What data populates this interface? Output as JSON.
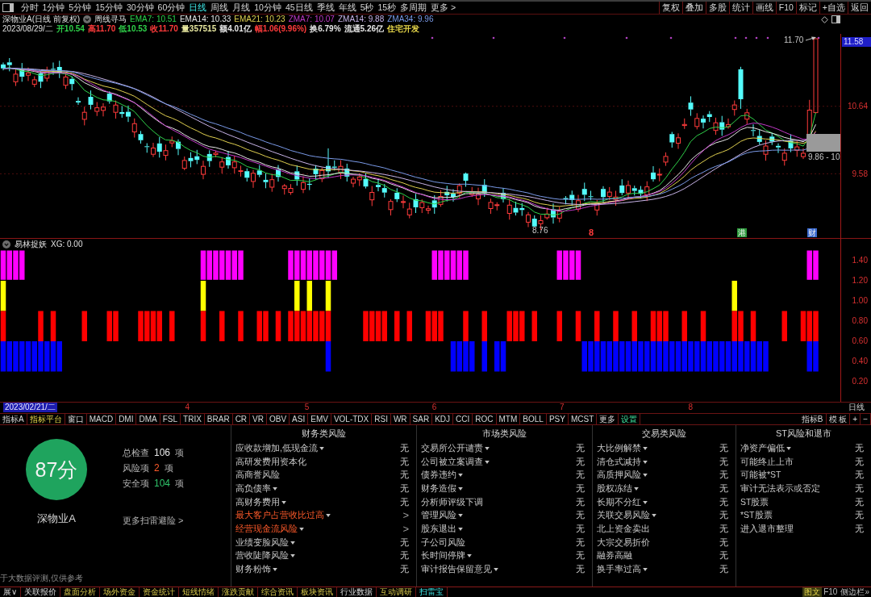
{
  "toolbar": {
    "periods": [
      {
        "label": "分时",
        "selected": false
      },
      {
        "label": "1分钟",
        "selected": false
      },
      {
        "label": "5分钟",
        "selected": false
      },
      {
        "label": "15分钟",
        "selected": false
      },
      {
        "label": "30分钟",
        "selected": false
      },
      {
        "label": "60分钟",
        "selected": false
      },
      {
        "label": "日线",
        "selected": true
      },
      {
        "label": "周线",
        "selected": false
      },
      {
        "label": "月线",
        "selected": false
      },
      {
        "label": "10分钟",
        "selected": false
      },
      {
        "label": "45日线",
        "selected": false
      },
      {
        "label": "季线",
        "selected": false
      },
      {
        "label": "年线",
        "selected": false
      },
      {
        "label": "5秒",
        "selected": false
      },
      {
        "label": "15秒",
        "selected": false
      },
      {
        "label": "多周期",
        "selected": false
      }
    ],
    "more": "更多 >",
    "actions": [
      "复权",
      "叠加",
      "多股",
      "统计",
      "画线",
      "F10",
      "标记",
      "+自选",
      "返回"
    ]
  },
  "quote_header": {
    "title": "深物业A(日线 前复权)",
    "formula": "周线寻马",
    "averages": [
      {
        "text": "EMA7: 10.51",
        "color": "#2fd24a"
      },
      {
        "text": "EMA14: 10.33",
        "color": "#e6e6e6"
      },
      {
        "text": "EMA21: 10.23",
        "color": "#e0d050"
      },
      {
        "text": "ZMA7: 10.07",
        "color": "#c23ac8"
      },
      {
        "text": "ZMA14: 9.88",
        "color": "#c8b4e8"
      },
      {
        "text": "ZMA34: 9.96",
        "color": "#7a9ae8"
      }
    ]
  },
  "quote_line": {
    "date": "2023/08/29/二",
    "fields": [
      {
        "text": "开10.54",
        "color": "#2fd24a"
      },
      {
        "text": "高11.70",
        "color": "#ff3b3b"
      },
      {
        "text": "低10.53",
        "color": "#2fd24a"
      },
      {
        "text": "收11.70",
        "color": "#ff3b3b"
      },
      {
        "text": "量357515",
        "color": "#e8e8a0"
      },
      {
        "text": "额4.01亿",
        "color": "#e6e6e6"
      },
      {
        "text": "幅1.06(9.96%)",
        "color": "#ff3b3b"
      },
      {
        "text": "换6.79%",
        "color": "#e6e6e6"
      },
      {
        "text": "流通5.26亿",
        "color": "#e6e6e6"
      },
      {
        "text": "住宅开发",
        "color": "#e8d84a"
      }
    ]
  },
  "price_chart": {
    "axis_labels": [
      {
        "text": "11.58",
        "kind": "current"
      },
      {
        "text": "10.64",
        "kind": "tick"
      },
      {
        "text": "9.58",
        "kind": "tick"
      }
    ],
    "high_label": "11.70",
    "low_label": "8.76",
    "range_label": "9.86 - 10",
    "event_marks": [
      {
        "text": "8",
        "kind": "plain",
        "color": "#ff3b3b"
      },
      {
        "text": "港",
        "kind": "boxed",
        "color": "#2a9a3a"
      },
      {
        "text": "财",
        "kind": "boxed",
        "color": "#3a6ad0"
      }
    ]
  },
  "indicator_panel": {
    "title": "易林捉妖",
    "reading": "XG: 0.00",
    "axis_labels": [
      "1.40",
      "1.20",
      "1.00",
      "0.80",
      "0.60",
      "0.40",
      "0.20"
    ]
  },
  "date_axis": {
    "start": "2023/02/21/二",
    "months": [
      "4",
      "5",
      "6",
      "7",
      "8"
    ],
    "period": "日线"
  },
  "indicator_tabs": {
    "tabs": [
      {
        "label": "指标A",
        "kind": "plain"
      },
      {
        "label": "指标平台",
        "kind": "accent"
      },
      {
        "label": "窗口",
        "kind": "plain"
      },
      {
        "label": "MACD",
        "kind": "plain"
      },
      {
        "label": "DMI",
        "kind": "plain"
      },
      {
        "label": "DMA",
        "kind": "plain"
      },
      {
        "label": "FSL",
        "kind": "plain"
      },
      {
        "label": "TRIX",
        "kind": "plain"
      },
      {
        "label": "BRAR",
        "kind": "plain"
      },
      {
        "label": "CR",
        "kind": "plain"
      },
      {
        "label": "VR",
        "kind": "plain"
      },
      {
        "label": "OBV",
        "kind": "plain"
      },
      {
        "label": "ASI",
        "kind": "plain"
      },
      {
        "label": "EMV",
        "kind": "plain"
      },
      {
        "label": "VOL-TDX",
        "kind": "plain"
      },
      {
        "label": "RSI",
        "kind": "plain"
      },
      {
        "label": "WR",
        "kind": "plain"
      },
      {
        "label": "SAR",
        "kind": "plain"
      },
      {
        "label": "KDJ",
        "kind": "plain"
      },
      {
        "label": "CCI",
        "kind": "plain"
      },
      {
        "label": "ROC",
        "kind": "plain"
      },
      {
        "label": "MTM",
        "kind": "plain"
      },
      {
        "label": "BOLL",
        "kind": "plain"
      },
      {
        "label": "PSY",
        "kind": "plain"
      },
      {
        "label": "MCST",
        "kind": "plain"
      },
      {
        "label": "更多",
        "kind": "plain"
      },
      {
        "label": "设置",
        "kind": "link"
      }
    ],
    "right": [
      "指标B",
      "模 板",
      "+",
      "−"
    ]
  },
  "risk_scan": {
    "score": "87分",
    "stock": "深物业A",
    "stats": [
      {
        "label": "总检查",
        "value": "106",
        "unit": "项",
        "kind": "total"
      },
      {
        "label": "风险项",
        "value": "2",
        "unit": "项",
        "kind": "risk"
      },
      {
        "label": "安全项",
        "value": "104",
        "unit": "项",
        "kind": "safe"
      }
    ],
    "more_link": "更多扫雷避险 >",
    "footnote": "于大数据评测,仅供参考",
    "categories": [
      {
        "title": "财务类风险",
        "items": [
          {
            "label": "应收款增加,低现金流",
            "expandable": true,
            "flagged": false,
            "result": "无"
          },
          {
            "label": "高研发费用资本化",
            "expandable": false,
            "flagged": false,
            "result": "无"
          },
          {
            "label": "高商誉风险",
            "expandable": false,
            "flagged": false,
            "result": "无"
          },
          {
            "label": "高负债率",
            "expandable": true,
            "flagged": false,
            "result": "无"
          },
          {
            "label": "高财务费用",
            "expandable": true,
            "flagged": false,
            "result": "无"
          },
          {
            "label": "最大客户占营收比过高",
            "expandable": true,
            "flagged": true,
            "result": ">"
          },
          {
            "label": "经营现金流风险",
            "expandable": true,
            "flagged": true,
            "result": ">"
          },
          {
            "label": "业绩变脸风险",
            "expandable": true,
            "flagged": false,
            "result": "无"
          },
          {
            "label": "营收陡降风险",
            "expandable": true,
            "flagged": false,
            "result": "无"
          },
          {
            "label": "财务粉饰",
            "expandable": true,
            "flagged": false,
            "result": "无"
          }
        ]
      },
      {
        "title": "市场类风险",
        "items": [
          {
            "label": "交易所公开谴责",
            "expandable": true,
            "flagged": false,
            "result": "无"
          },
          {
            "label": "公司被立案调查",
            "expandable": true,
            "flagged": false,
            "result": "无"
          },
          {
            "label": "债券违约",
            "expandable": true,
            "flagged": false,
            "result": "无"
          },
          {
            "label": "财务造假",
            "expandable": true,
            "flagged": false,
            "result": "无"
          },
          {
            "label": "分析师评级下调",
            "expandable": false,
            "flagged": false,
            "result": "无"
          },
          {
            "label": "管理风险",
            "expandable": true,
            "flagged": false,
            "result": "无"
          },
          {
            "label": "股东退出",
            "expandable": true,
            "flagged": false,
            "result": "无"
          },
          {
            "label": "子公司风险",
            "expandable": false,
            "flagged": false,
            "result": "无"
          },
          {
            "label": "长时间停牌",
            "expandable": true,
            "flagged": false,
            "result": "无"
          },
          {
            "label": "审计报告保留意见",
            "expandable": true,
            "flagged": false,
            "result": "无"
          }
        ]
      },
      {
        "title": "交易类风险",
        "items": [
          {
            "label": "大比例解禁",
            "expandable": true,
            "flagged": false,
            "result": "无"
          },
          {
            "label": "清仓式减持",
            "expandable": true,
            "flagged": false,
            "result": "无"
          },
          {
            "label": "高质押风险",
            "expandable": true,
            "flagged": false,
            "result": "无"
          },
          {
            "label": "股权冻结",
            "expandable": true,
            "flagged": false,
            "result": "无"
          },
          {
            "label": "长期不分红",
            "expandable": true,
            "flagged": false,
            "result": "无"
          },
          {
            "label": "关联交易风险",
            "expandable": true,
            "flagged": false,
            "result": "无"
          },
          {
            "label": "北上资金卖出",
            "expandable": false,
            "flagged": false,
            "result": "无"
          },
          {
            "label": "大宗交易折价",
            "expandable": false,
            "flagged": false,
            "result": "无"
          },
          {
            "label": "融券高融",
            "expandable": false,
            "flagged": false,
            "result": "无"
          },
          {
            "label": "换手率过高",
            "expandable": true,
            "flagged": false,
            "result": "无"
          }
        ]
      },
      {
        "title": "ST风险和退市",
        "items": [
          {
            "label": "净资产偏低",
            "expandable": true,
            "flagged": false,
            "result": "无"
          },
          {
            "label": "可能终止上市",
            "expandable": false,
            "flagged": false,
            "result": "无"
          },
          {
            "label": "可能被*ST",
            "expandable": false,
            "flagged": false,
            "result": "无"
          },
          {
            "label": "审计无法表示或否定",
            "expandable": false,
            "flagged": false,
            "result": "无"
          },
          {
            "label": "ST股票",
            "expandable": false,
            "flagged": false,
            "result": "无"
          },
          {
            "label": "*ST股票",
            "expandable": false,
            "flagged": false,
            "result": "无"
          },
          {
            "label": "进入退市整理",
            "expandable": false,
            "flagged": false,
            "result": "无"
          }
        ]
      }
    ]
  },
  "bottom_tabs": [
    {
      "label": "展∨",
      "kind": "plain",
      "selected": false
    },
    {
      "label": "关联报价",
      "kind": "plain",
      "selected": false
    },
    {
      "label": "盘面分析",
      "kind": "feature",
      "selected": false
    },
    {
      "label": "场外资金",
      "kind": "feature",
      "selected": false
    },
    {
      "label": "资金统计",
      "kind": "feature",
      "selected": false
    },
    {
      "label": "短线情绪",
      "kind": "feature",
      "selected": false
    },
    {
      "label": "涨跌贡献",
      "kind": "feature",
      "selected": false
    },
    {
      "label": "综合资讯",
      "kind": "feature",
      "selected": false
    },
    {
      "label": "板块资讯",
      "kind": "feature",
      "selected": false
    },
    {
      "label": "行业数据",
      "kind": "plain",
      "selected": false
    },
    {
      "label": "互动调研",
      "kind": "feature",
      "selected": false
    },
    {
      "label": "扫雷宝",
      "kind": "feature",
      "selected": true
    }
  ],
  "bottom_right": [
    {
      "label": "图文",
      "kind": "accent"
    },
    {
      "label": "F10",
      "kind": "plain"
    },
    {
      "label": "侧边栏»",
      "kind": "plain"
    }
  ]
}
